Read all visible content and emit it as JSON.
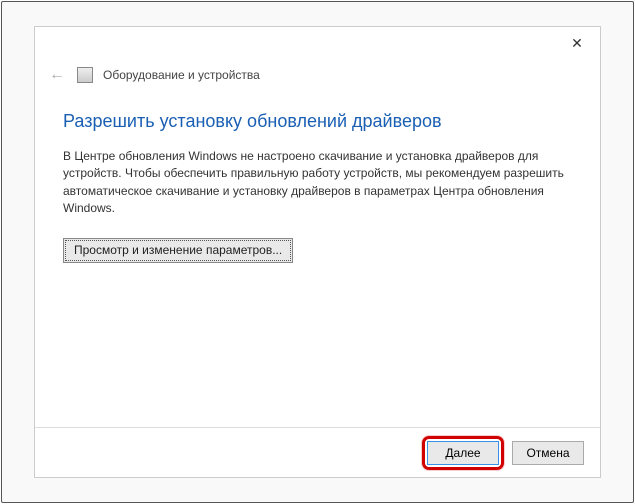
{
  "header": {
    "title": "Оборудование и устройства"
  },
  "content": {
    "heading": "Разрешить установку обновлений драйверов",
    "body": "В Центре обновления Windows не настроено скачивание и установка драйверов для устройств. Чтобы обеспечить правильную работу устройств, мы рекомендуем разрешить автоматическое скачивание и установку драйверов в параметрах Центра обновления Windows.",
    "param_button": "Просмотр и изменение параметров..."
  },
  "footer": {
    "next": "Далее",
    "cancel": "Отмена"
  },
  "icons": {
    "close": "✕",
    "back": "←"
  }
}
